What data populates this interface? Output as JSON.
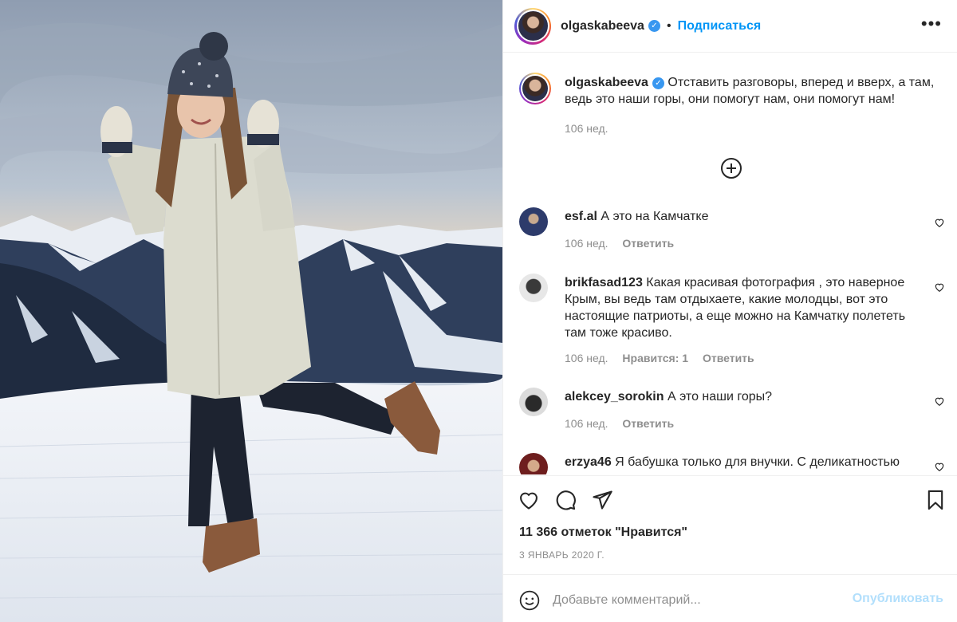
{
  "header": {
    "username": "olgaskabeeva",
    "separator": "•",
    "follow_label": "Подписаться",
    "more_icon": "more-horizontal-icon"
  },
  "caption": {
    "username": "olgaskabeeva",
    "text": "Отставить разговоры, вперед и вверх, а там, ведь это наши горы, они помогут нам, они помогут нам!",
    "time": "106 нед."
  },
  "comments": [
    {
      "username": "esf.al",
      "text": "А это на Камчатке",
      "time": "106 нед.",
      "likes": "",
      "reply": "Ответить"
    },
    {
      "username": "brikfasad123",
      "text": "Какая красивая фотография , это наверное Крым, вы ведь там отдыхаете, какие молодцы, вот это настоящие патриоты, а еще можно на Камчатку полететь там тоже красиво.",
      "time": "106 нед.",
      "likes": "Нравится: 1",
      "reply": "Ответить"
    },
    {
      "username": "alekcey_sorokin",
      "text": "А это наши горы?",
      "time": "106 нед.",
      "likes": "",
      "reply": "Ответить"
    },
    {
      "username": "erzya46",
      "text": "Я бабушка только для внучки. С деликатностью",
      "time": "",
      "likes": "",
      "reply": ""
    }
  ],
  "stats": {
    "likes": "11 366 отметок \"Нравится\"",
    "date": "3 ЯНВАРЬ 2020 Г."
  },
  "add_comment": {
    "placeholder": "Добавьте комментарий...",
    "publish_label": "Опубликовать"
  },
  "colors": {
    "link": "#0095f6",
    "verified": "#3897f0",
    "muted": "#8e8e8e",
    "publish_disabled": "#b2dffc"
  }
}
